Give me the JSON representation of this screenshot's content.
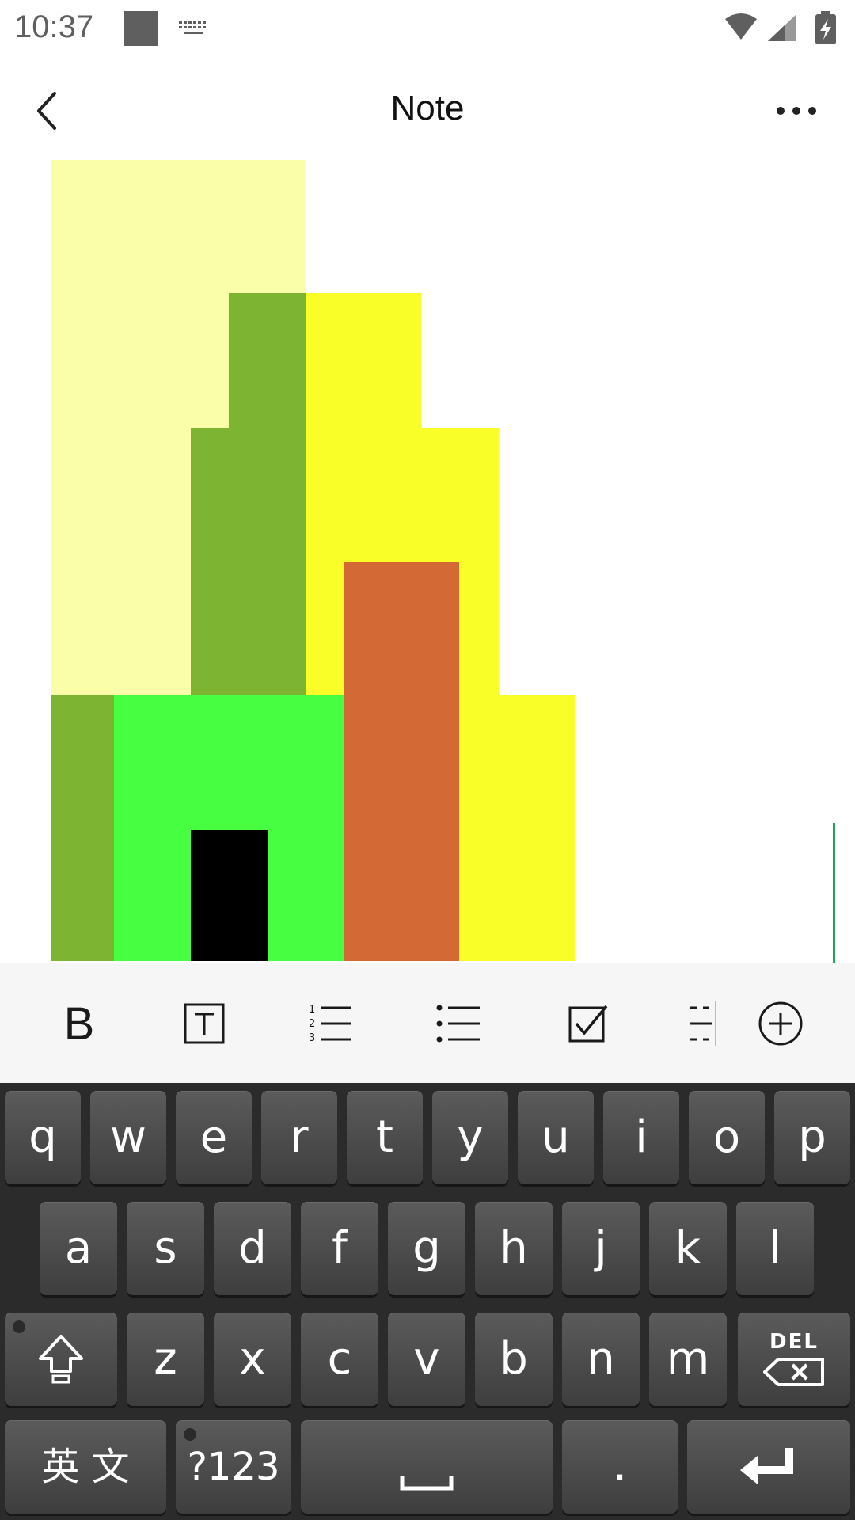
{
  "status_bar": {
    "time": "10:37",
    "icons": [
      "notification-square-icon",
      "keyboard-icon",
      "wifi-icon",
      "cell-signal-icon",
      "battery-charging-icon"
    ]
  },
  "title_bar": {
    "title": "Note",
    "back_icon": "chevron-left-icon",
    "more_icon": "more-horizontal-icon"
  },
  "note": {
    "image_colors": {
      "pale_yellow": "#fafea8",
      "olive_green": "#7db432",
      "yellow": "#fafe28",
      "bright_green": "#48fe40",
      "orange": "#d36a36",
      "black": "#000000"
    },
    "cursor_color": "#19a85a"
  },
  "format_toolbar": {
    "bold_label": "B",
    "tools": [
      "bold",
      "text-style-icon",
      "numbered-list-icon",
      "bullet-list-icon",
      "checkbox-icon",
      "divider-icon",
      "add-circle-icon"
    ]
  },
  "keyboard": {
    "row1": [
      "q",
      "w",
      "e",
      "r",
      "t",
      "y",
      "u",
      "i",
      "o",
      "p"
    ],
    "row2": [
      "a",
      "s",
      "d",
      "f",
      "g",
      "h",
      "j",
      "k",
      "l"
    ],
    "row3": [
      "z",
      "x",
      "c",
      "v",
      "b",
      "n",
      "m"
    ],
    "shift_icon": "shift-icon",
    "delete_label": "DEL",
    "lang_label": "英 文",
    "symbols_label": "?123",
    "space_icon": "space-bar-icon",
    "period_label": "·",
    "enter_icon": "enter-icon"
  }
}
